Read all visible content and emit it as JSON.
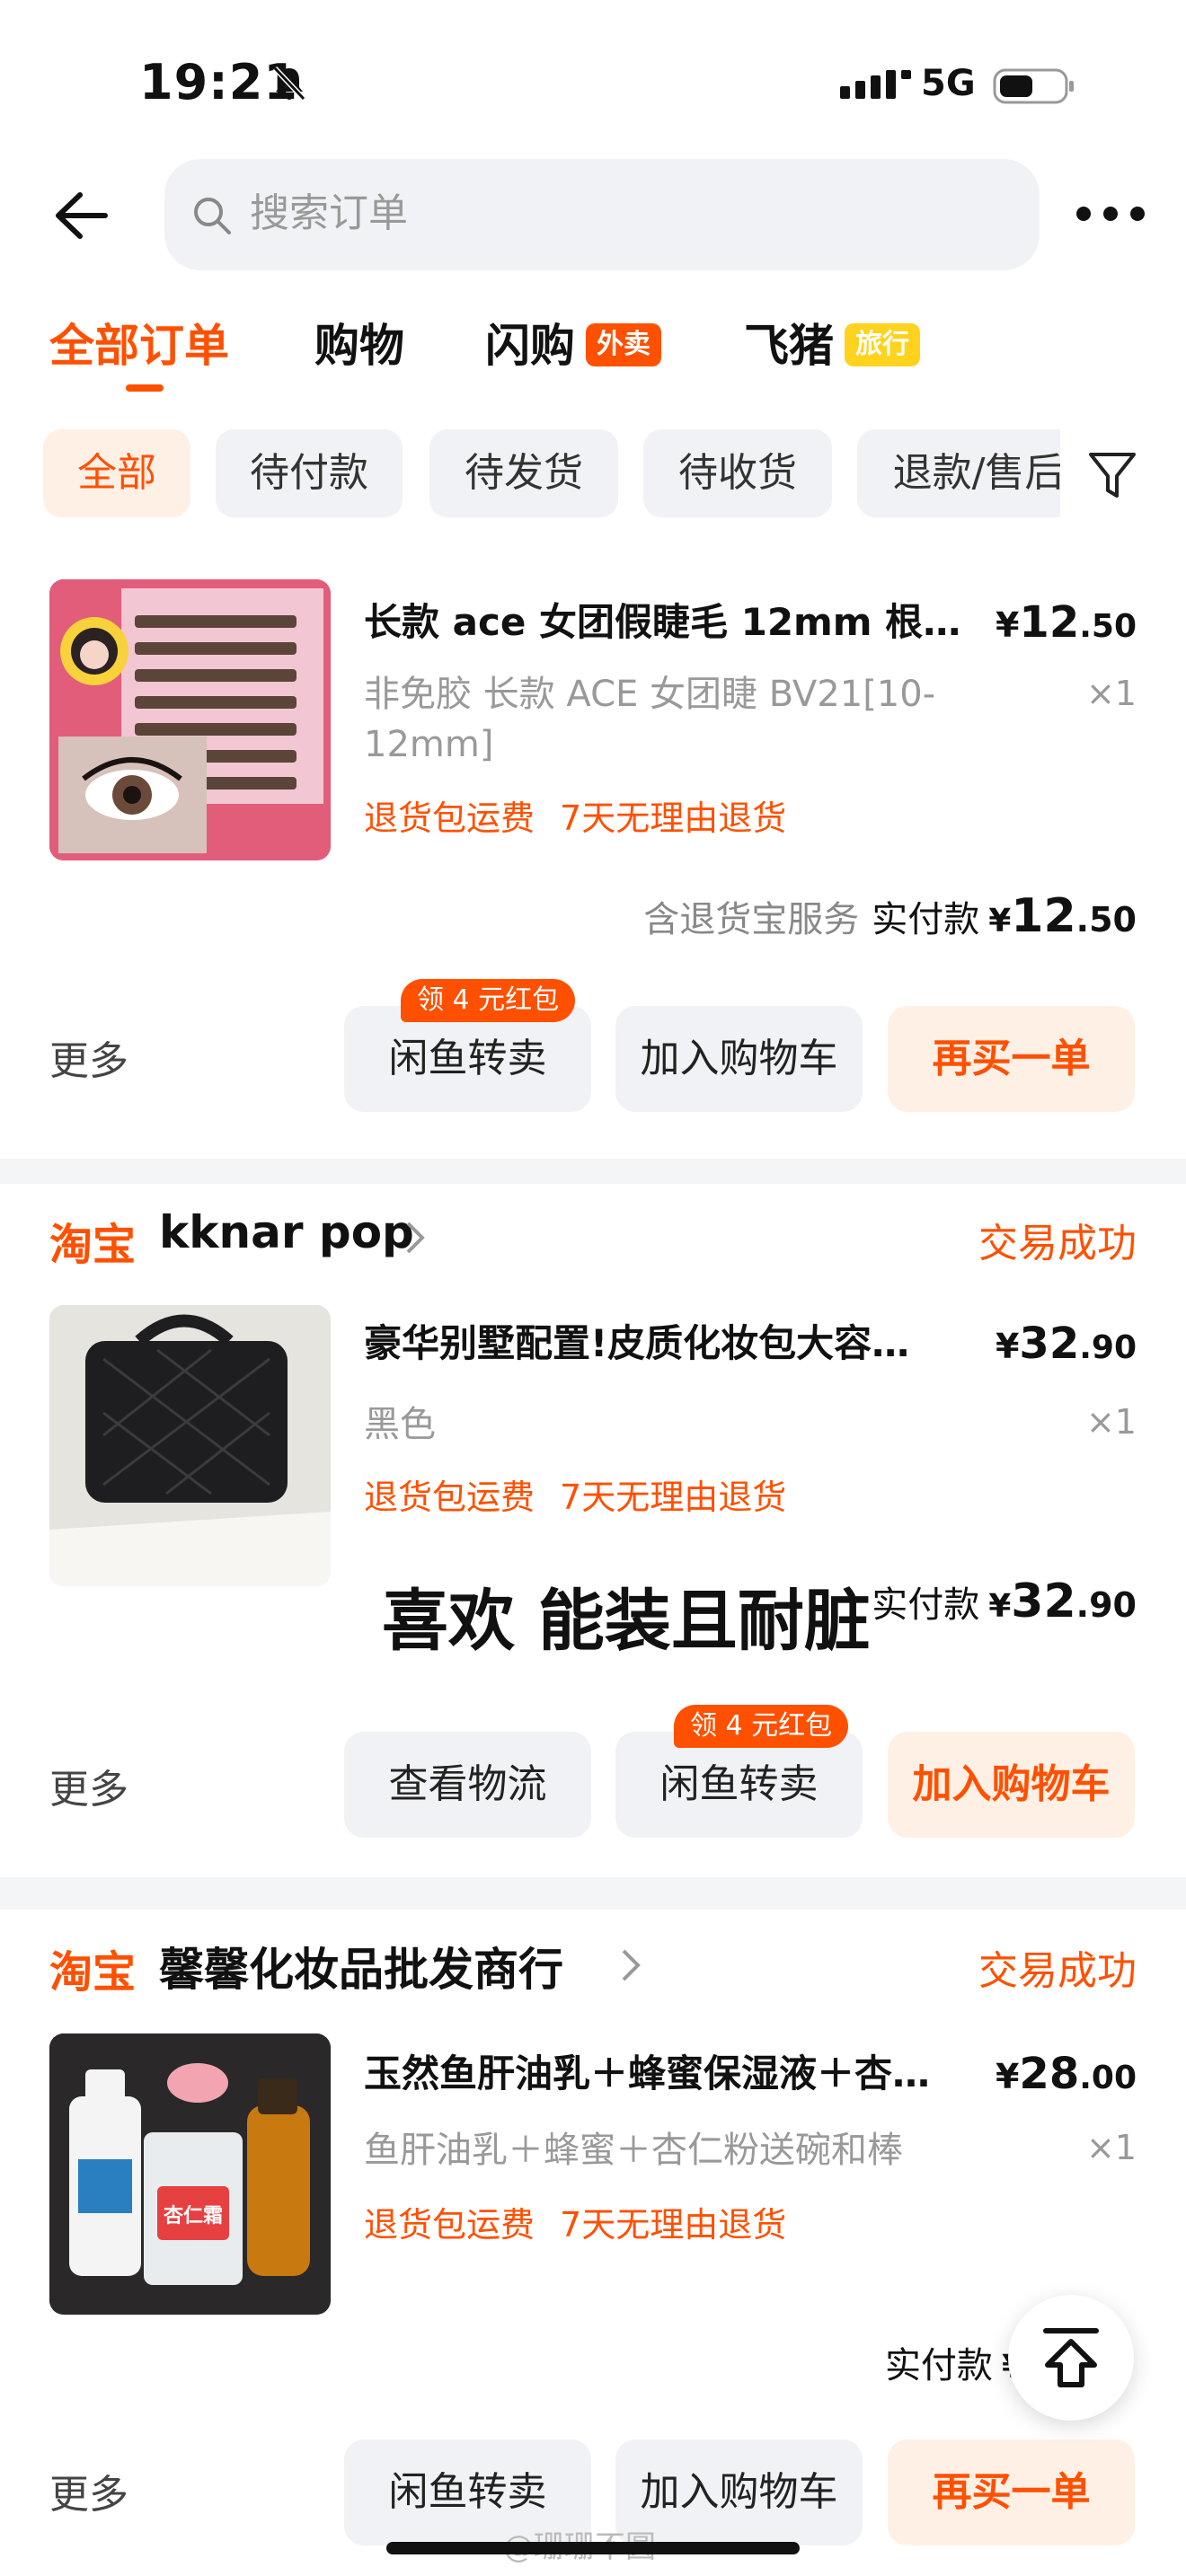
{
  "status_bar": {
    "time": "19:21",
    "network": "5G"
  },
  "search": {
    "placeholder": "搜索订单"
  },
  "tabs": [
    {
      "label": "全部订单",
      "active": true
    },
    {
      "label": "购物",
      "active": false
    },
    {
      "label": "闪购",
      "badge": "外卖",
      "active": false
    },
    {
      "label": "飞猪",
      "badge": "旅行",
      "active": false
    }
  ],
  "filters": [
    {
      "label": "全部",
      "active": true
    },
    {
      "label": "待付款",
      "active": false
    },
    {
      "label": "待发货",
      "active": false
    },
    {
      "label": "待收货",
      "active": false
    },
    {
      "label": "退款/售后",
      "active": false
    }
  ],
  "orders": [
    {
      "title": "长款 ace 女团假睫毛 12mm 根根…",
      "price": {
        "symbol": "¥",
        "int": "12",
        "dec": ".50"
      },
      "spec": "非免胶 长款 ACE 女团睫 BV21[10-12mm]",
      "qty": "×1",
      "promos": [
        "退货包运费",
        "7天无理由退货"
      ],
      "service_note": "含退货宝服务",
      "paid_label": "实付款",
      "paid": {
        "symbol": "¥",
        "int": "12",
        "dec": ".50"
      },
      "more": "更多",
      "coupon": "领 4 元红包",
      "buttons": [
        "闲鱼转卖",
        "加入购物车",
        "再买一单"
      ]
    },
    {
      "shop_logo": "淘宝",
      "shop_name": "kknar pop",
      "status": "交易成功",
      "title": "豪华别墅配置!皮质化妆包大容…",
      "price": {
        "symbol": "¥",
        "int": "32",
        "dec": ".90"
      },
      "spec": "黑色",
      "qty": "×1",
      "promos": [
        "退货包运费",
        "7天无理由退货"
      ],
      "paid_label": "实付款",
      "paid": {
        "symbol": "¥",
        "int": "32",
        "dec": ".90"
      },
      "more": "更多",
      "coupon": "领 4 元红包",
      "buttons": [
        "查看物流",
        "闲鱼转卖",
        "加入购物车"
      ],
      "overlay_comment": "喜欢 能装且耐脏"
    },
    {
      "shop_logo": "淘宝",
      "shop_name": "馨馨化妆品批发商行",
      "status": "交易成功",
      "title": "玉然鱼肝油乳＋蜂蜜保湿液＋杏…",
      "price": {
        "symbol": "¥",
        "int": "28",
        "dec": ".00"
      },
      "spec": "鱼肝油乳＋蜂蜜＋杏仁粉送碗和棒",
      "qty": "×1",
      "promos": [
        "退货包运费",
        "7天无理由退货"
      ],
      "paid_label": "实付款",
      "paid_partial": "¥",
      "more": "更多",
      "buttons": [
        "闲鱼转卖",
        "加入购物车",
        "再买一单"
      ],
      "product_label": "杏仁霜"
    }
  ],
  "watermark": "@珊珊不圆",
  "colors": {
    "accent": "#ff5000",
    "accent_bg": "#fff0e6",
    "chip_bg": "#f1f2f5",
    "badge_yellow": "#ffd21e"
  }
}
